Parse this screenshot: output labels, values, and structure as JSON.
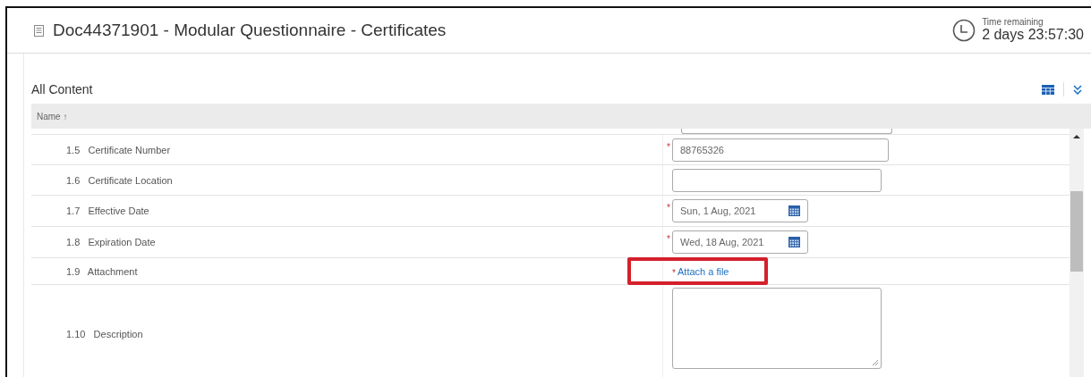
{
  "window": {
    "title": "Doc44371901 - Modular Questionnaire - Certificates"
  },
  "timer": {
    "label": "Time remaining",
    "value": "2 days 23:57:30"
  },
  "section": {
    "title": "All Content"
  },
  "table": {
    "columns": [
      {
        "label": "Name ↑"
      }
    ],
    "rows": [
      {
        "number": "1.5",
        "label": "Certificate Number",
        "kind": "text",
        "required_mark": "*",
        "value": "88765326",
        "highlighted": false
      },
      {
        "number": "1.6",
        "label": "Certificate Location",
        "kind": "text",
        "highlighted": false
      },
      {
        "number": "1.7",
        "label": "Effective Date",
        "kind": "date",
        "required_mark": "*",
        "value": "Sun, 1 Aug, 2021",
        "highlighted": false
      },
      {
        "number": "1.8",
        "label": "Expiration Date",
        "kind": "date",
        "required_mark": "*",
        "value": "Wed, 18 Aug, 2021",
        "highlighted": false
      },
      {
        "number": "1.9",
        "label": "Attachment",
        "kind": "attachment",
        "required_mark": "*",
        "link": "Attach a file",
        "highlighted": true
      },
      {
        "number": "1.10",
        "label": "Description",
        "kind": "textarea",
        "highlighted": false
      }
    ]
  }
}
